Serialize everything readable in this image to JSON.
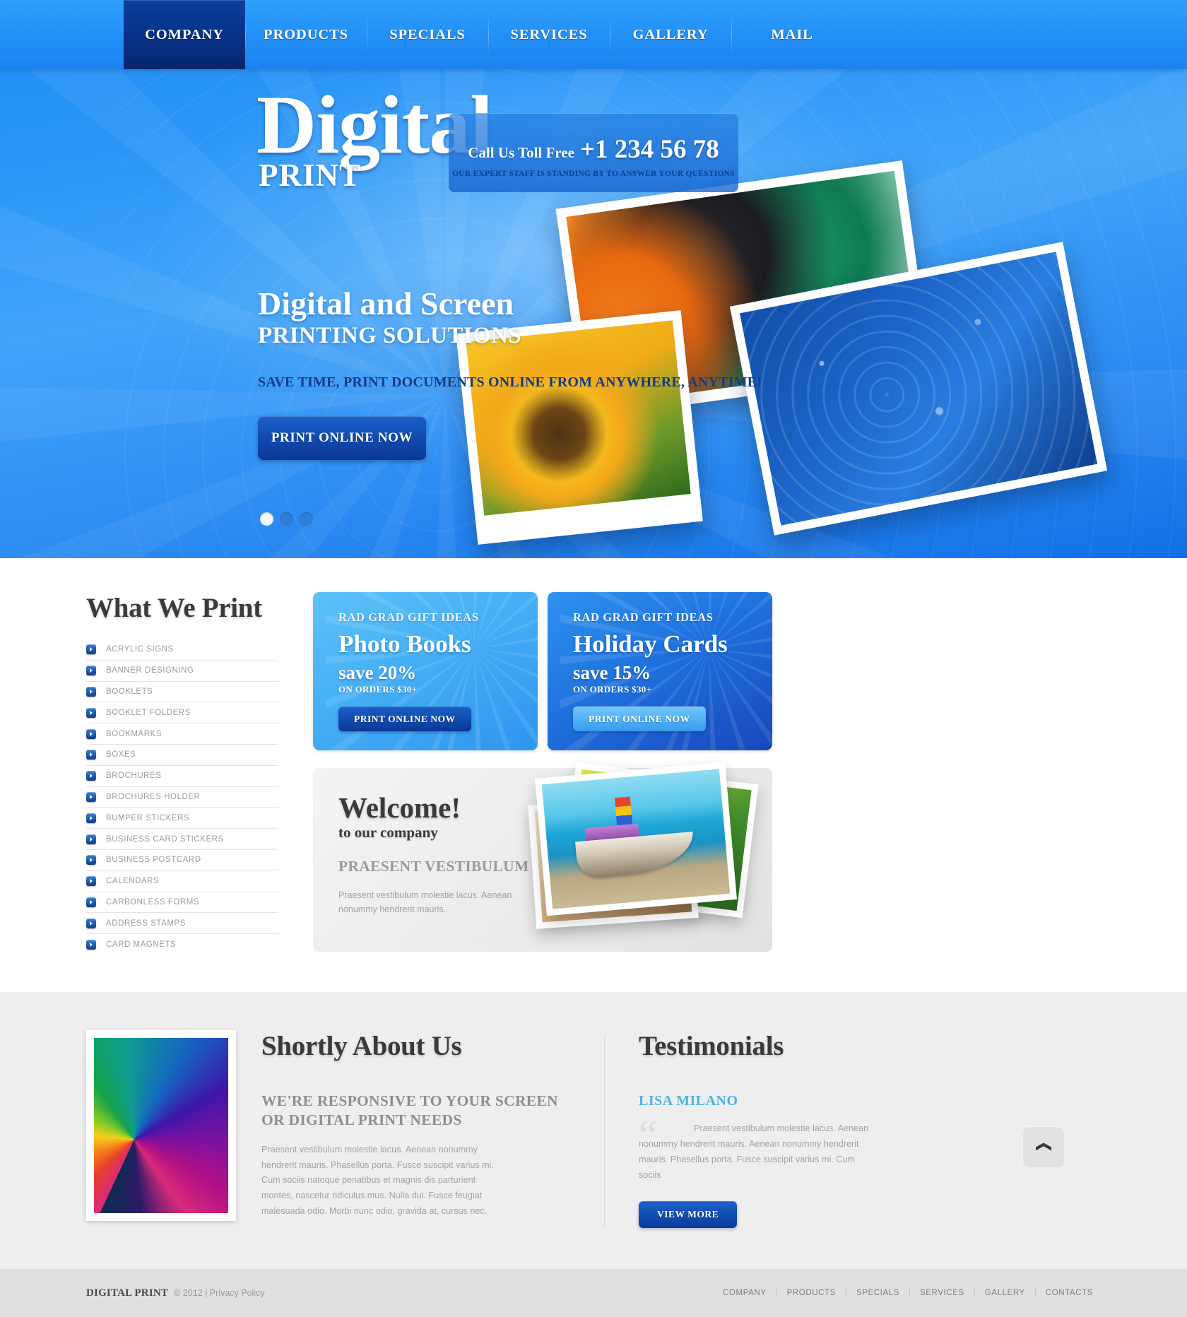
{
  "nav": {
    "items": [
      {
        "label": "COMPANY",
        "active": true
      },
      {
        "label": "PRODUCTS",
        "active": false
      },
      {
        "label": "SPECIALS",
        "active": false
      },
      {
        "label": "SERVICES",
        "active": false
      },
      {
        "label": "GALLERY",
        "active": false
      },
      {
        "label": "MAIL",
        "active": false
      }
    ]
  },
  "logo": {
    "main": "Digital",
    "sub": "PRINT"
  },
  "callbox": {
    "label": "Call Us Toll Free",
    "phone": "+1 234 56 78",
    "note": "OUR EXPERT STAFF IS STANDING BY TO ANSWER YOUR QUESTIONS"
  },
  "hero": {
    "headline": "Digital and Screen",
    "subheadline": "PRINTING SOLUTIONS",
    "tagline": "SAVE TIME, PRINT DOCUMENTS ONLINE FROM ANYWHERE, ANYTIME!",
    "cta": "PRINT ONLINE NOW",
    "slides": 3,
    "active_slide": 1
  },
  "what_we_print": {
    "title": "What We Print",
    "items": [
      "ACRYLIC SIGNS",
      "BANNER DESIGNING",
      "BOOKLETS",
      "BOOKLET FOLDERS",
      "BOOKMARKS",
      "BOXES",
      "BROCHURES",
      "BROCHURES HOLDER",
      "BUMPER STICKERS",
      "BUSINESS CARD STICKERS",
      "BUSINESS POSTCARD",
      "CALENDARS",
      "CARBONLESS FORMS",
      "ADDRESS STAMPS",
      "CARD MAGNETS"
    ]
  },
  "promos": [
    {
      "kicker": "RAD GRAD GIFT IDEAS",
      "title": "Photo Books",
      "save": "save 20%",
      "orders": "ON ORDERS $30+",
      "button": "PRINT ONLINE NOW"
    },
    {
      "kicker": "RAD GRAD GIFT IDEAS",
      "title": "Holiday Cards",
      "save": "save 15%",
      "orders": "ON ORDERS $30+",
      "button": "PRINT ONLINE NOW"
    }
  ],
  "welcome": {
    "title": "Welcome!",
    "subtitle": "to our company",
    "heading": "PRAESENT VESTIBULUM MOLESTIE LACUS",
    "text": "Praesent vestibulum molestie lacus. Aenean nonummy hendrerit mauris."
  },
  "about": {
    "title": "Shortly About Us",
    "heading": "WE'RE RESPONSIVE TO YOUR SCREEN OR DIGITAL PRINT NEEDS",
    "text": "Praesent vestibulum molestie lacus. Aenean nonummy hendrerit mauris. Phasellus porta. Fusce suscipit varius mi. Cum sociis natoque penatibus et magnis dis parturient montes, nascetur ridiculus mus. Nulla dui. Fusce feugiat malesuada odio. Morbi nunc odio, gravida at, cursus nec."
  },
  "testimonials": {
    "title": "Testimonials",
    "author": "LISA MILANO",
    "quote": "Praesent vestibulum molestie lacus. Aenean nonummy hendrerit mauris. Aenean nonummy hendrerit mauris. Phasellus porta. Fusce suscipit varius mi. Cum sociis",
    "button": "VIEW MORE"
  },
  "footer": {
    "brand": "DIGITAL PRINT",
    "copyright": "© 2012  |  Privacy Policy",
    "nav": [
      "COMPANY",
      "PRODUCTS",
      "SPECIALS",
      "SERVICES",
      "GALLERY",
      "CONTACTS"
    ]
  },
  "colors": {
    "accent_blue": "#2391f7",
    "dark_blue": "#0b3f9e",
    "button_blue": "#124db2",
    "testimonial_name": "#4cb3e4",
    "grey_band": "#eeeeee",
    "footer_bg": "#e0e0e0"
  }
}
